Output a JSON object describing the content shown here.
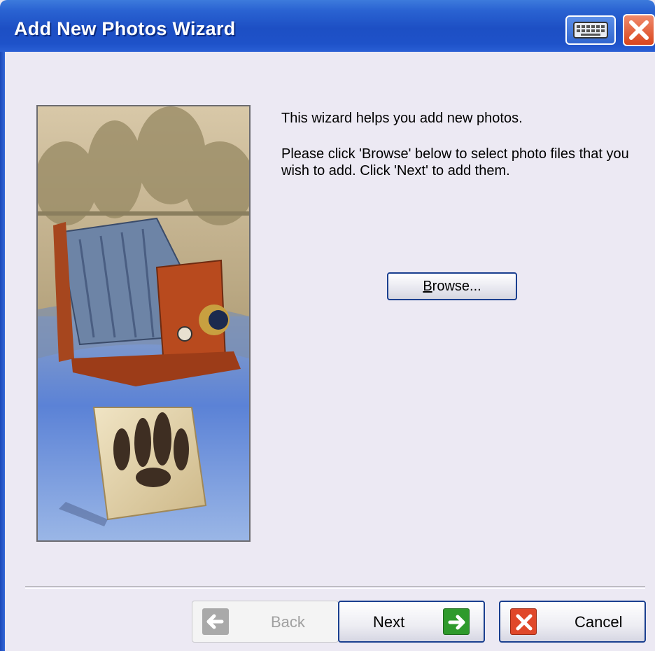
{
  "window": {
    "title": "Add New Photos Wizard",
    "title_bar_color": "#245ad0",
    "buttons": {
      "keyboard_icon": "keyboard-icon",
      "close_icon": "close-icon"
    }
  },
  "content": {
    "intro": "This wizard helps you add new photos.",
    "instructions": "Please click 'Browse' below to select photo files that you wish to add. Click 'Next' to add them.",
    "browse_label_mnemonic": "B",
    "browse_label_rest": "rowse..."
  },
  "footer": {
    "back_label": "Back",
    "next_label": "Next",
    "cancel_label": "Cancel",
    "back_icon": "arrow-left-icon",
    "next_icon": "arrow-right-icon",
    "cancel_icon": "close-icon"
  },
  "colors": {
    "next_arrow": "#2f9a2c",
    "cancel_x": "#e0482a",
    "back_disabled": "#a9a9a9"
  }
}
